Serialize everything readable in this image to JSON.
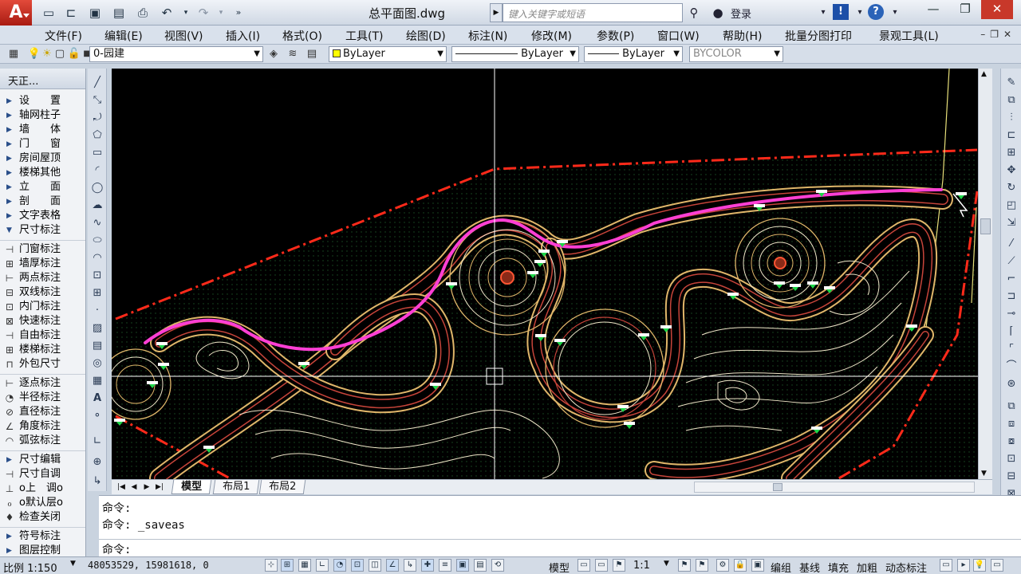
{
  "window": {
    "title": "总平面图.dwg",
    "search_placeholder": "键入关键字或短语",
    "login_label": "登录"
  },
  "menu": [
    "文件(F)",
    "编辑(E)",
    "视图(V)",
    "插入(I)",
    "格式(O)",
    "工具(T)",
    "绘图(D)",
    "标注(N)",
    "修改(M)",
    "参数(P)",
    "窗口(W)",
    "帮助(H)",
    "批量分图打印",
    "景观工具(L)"
  ],
  "layer_toolbar": {
    "layer": "0-园建",
    "color": "ByLayer",
    "linetype": "ByLayer",
    "lineweight": "ByLayer",
    "plotstyle": "BYCOLOR"
  },
  "tianzheng": {
    "header": "天正...",
    "group1": [
      "设　　置",
      "轴网柱子",
      "墙　　体",
      "门　　窗",
      "房间屋顶",
      "楼梯其他",
      "立　　面",
      "剖　　面",
      "文字表格",
      "尺寸标注"
    ],
    "group2": [
      "门窗标注",
      "墙厚标注",
      "两点标注",
      "双线标注",
      "内门标注",
      "快速标注",
      "自由标注",
      "楼梯标注",
      "外包尺寸"
    ],
    "group3": [
      "逐点标注",
      "半径标注",
      "直径标注",
      "角度标注",
      "弧弦标注"
    ],
    "group4": [
      "尺寸编辑",
      "尺寸自调",
      "o上　调o",
      "o默认层o",
      "检查关闭"
    ],
    "group5": [
      "符号标注",
      "图层控制"
    ]
  },
  "layout_tabs": [
    "模型",
    "布局1",
    "布局2"
  ],
  "command": {
    "line1": "命令:",
    "line2": "命令: _saveas",
    "prompt": "命令:"
  },
  "status": {
    "scale": "比例 1:150",
    "coords": "48053529, 15981618, 0",
    "model": "模型",
    "annoscale": "1:1",
    "btns": [
      "编组",
      "基线",
      "填充",
      "加粗",
      "动态标注"
    ]
  },
  "colors": {
    "path": "#ff3fd4",
    "boundary": "#ff2a1a",
    "paving": "#e0b66a",
    "paving_inner": "#c6443a",
    "contour": "#efe6c8",
    "crosshair": "#ffffff"
  }
}
